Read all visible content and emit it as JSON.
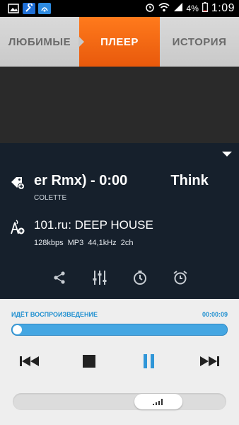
{
  "status_bar": {
    "battery_percent": "4%",
    "time": "1:09",
    "icons": [
      "gallery-icon",
      "tools-icon",
      "app-icon",
      "alarm-icon",
      "wifi-icon",
      "signal-icon",
      "battery-icon"
    ]
  },
  "tabs": [
    {
      "label": "ЛЮБИМЫЕ",
      "active": false
    },
    {
      "label": "ПЛЕЕР",
      "active": true
    },
    {
      "label": "ИСТОРИЯ",
      "active": false
    }
  ],
  "track": {
    "title": "er Rmx) - 0:00           Think",
    "artist": "COLETTE"
  },
  "station": {
    "name": "101.ru: DEEP HOUSE",
    "meta": "128kbps MP3 44,1kHz 2ch"
  },
  "actions": [
    "share-icon",
    "equalizer-icon",
    "sleep-timer-icon",
    "alarm-clock-icon"
  ],
  "playback": {
    "status": "ИДЁТ ВОСПРОИЗВЕДЕНИЕ",
    "elapsed": "00:00:09",
    "progress": 1.0
  },
  "volume": {
    "level": 0.68
  },
  "colors": {
    "accent_orange": "#f06a15",
    "panel_dark": "#16202c",
    "progress_blue": "#44a6e2",
    "label_blue": "#1e8fd0"
  }
}
